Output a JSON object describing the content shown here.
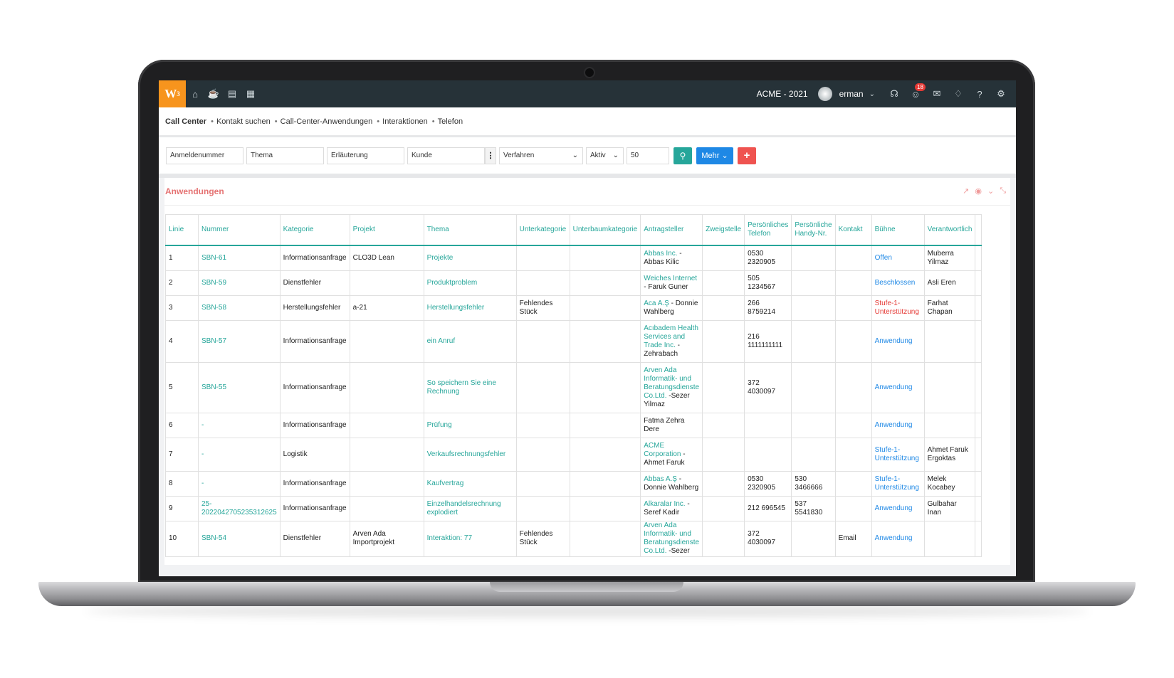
{
  "topbar": {
    "logo": "W",
    "logo_sup": "3",
    "nav_icons": [
      "home-icon",
      "coffee-icon",
      "chart-icon",
      "calendar-icon"
    ],
    "company": "ACME - 2021",
    "username": "erman",
    "notification_count": "18",
    "right_icons": [
      "headset-icon",
      "emoji-icon",
      "chat-icon",
      "bell-icon",
      "help-icon",
      "gear-icon"
    ]
  },
  "breadcrumb": {
    "items": [
      "Call Center",
      "Kontakt suchen",
      "Call-Center-Anwendungen",
      "Interaktionen",
      "Telefon"
    ]
  },
  "filters": {
    "registration_number": "Anmeldenummer",
    "topic": "Thema",
    "explanation": "Erläuterung",
    "customer": "Kunde",
    "procedure": "Verfahren",
    "status": "Aktiv",
    "page_size": "50",
    "more_label": "Mehr",
    "add_label": "+"
  },
  "panel": {
    "title": "Anwendungen"
  },
  "table": {
    "headers": [
      "Linie",
      "Nummer",
      "Kategorie",
      "Projekt",
      "Thema",
      "Unterkategorie",
      "Unterbaumkategorie",
      "Antragsteller",
      "Zweigstelle",
      "Persönliches Telefon",
      "Persönliche Handy-Nr.",
      "Kontakt",
      "Bühne",
      "Verantwortlich",
      ""
    ],
    "rows": [
      {
        "line": "1",
        "number": "SBN-61",
        "category": "Informationsanfrage",
        "project": "CLO3D Lean",
        "topic": "Projekte",
        "subcategory": "",
        "subtree": "",
        "applicant_link": "Abbas Inc.",
        "applicant_rest": " - Abbas Kilic",
        "branch": "",
        "phone": "0530 2320905",
        "mobile": "",
        "contact": "",
        "stage": "Offen",
        "stage_color": "blue",
        "responsible": "Muberra Yilmaz"
      },
      {
        "line": "2",
        "number": "SBN-59",
        "category": "Dienstfehler",
        "project": "",
        "topic": "Produktproblem",
        "subcategory": "",
        "subtree": "",
        "applicant_link": "Weiches Internet",
        "applicant_rest": " - Faruk Guner",
        "branch": "",
        "phone": "505 1234567",
        "mobile": "",
        "contact": "",
        "stage": "Beschlossen",
        "stage_color": "blue",
        "responsible": "Asli Eren"
      },
      {
        "line": "3",
        "number": "SBN-58",
        "category": "Herstellungsfehler",
        "project": "a-21",
        "topic": "Herstellungsfehler",
        "subcategory": "Fehlendes Stück",
        "subtree": "",
        "applicant_link": "Aca A.Ş",
        "applicant_rest": " - Donnie Wahlberg",
        "branch": "",
        "phone": "266 8759214",
        "mobile": "",
        "contact": "",
        "stage": "Stufe-1-Unterstützung",
        "stage_color": "red",
        "responsible": "Farhat Chapan"
      },
      {
        "line": "4",
        "number": "SBN-57",
        "category": "Informationsanfrage",
        "project": "",
        "topic": "ein Anruf",
        "subcategory": "",
        "subtree": "",
        "applicant_link": "Acıbadem Health Services and Trade Inc.",
        "applicant_rest": " - Zehrabach",
        "branch": "",
        "phone": "216 1111111111",
        "mobile": "",
        "contact": "",
        "stage": "Anwendung",
        "stage_color": "blue",
        "responsible": ""
      },
      {
        "line": "5",
        "number": "SBN-55",
        "category": "Informationsanfrage",
        "project": "",
        "topic": "So speichern Sie eine Rechnung",
        "subcategory": "",
        "subtree": "",
        "applicant_link": "Arven Ada Informatik- und Beratungsdienste Co.Ltd.",
        "applicant_rest": " -Sezer Yilmaz",
        "branch": "",
        "phone": "372 4030097",
        "mobile": "",
        "contact": "",
        "stage": "Anwendung",
        "stage_color": "blue",
        "responsible": ""
      },
      {
        "line": "6",
        "number": "-",
        "category": "Informationsanfrage",
        "project": "",
        "topic": "Prüfung",
        "subcategory": "",
        "subtree": "",
        "applicant_link": "",
        "applicant_rest": "Fatma Zehra Dere",
        "branch": "",
        "phone": "",
        "mobile": "",
        "contact": "",
        "stage": "Anwendung",
        "stage_color": "blue",
        "responsible": ""
      },
      {
        "line": "7",
        "number": "-",
        "category": "Logistik",
        "project": "",
        "topic": "Verkaufsrechnungsfehler",
        "subcategory": "",
        "subtree": "",
        "applicant_link": "ACME Corporation",
        "applicant_rest": " - Ahmet Faruk",
        "branch": "",
        "phone": "",
        "mobile": "",
        "contact": "",
        "stage": "Stufe-1-Unterstützung",
        "stage_color": "blue",
        "responsible": "Ahmet Faruk Ergoktas"
      },
      {
        "line": "8",
        "number": "-",
        "category": "Informationsanfrage",
        "project": "",
        "topic": "Kaufvertrag",
        "subcategory": "",
        "subtree": "",
        "applicant_link": "Abbas A.Ş",
        "applicant_rest": " - Donnie Wahlberg",
        "branch": "",
        "phone": "0530 2320905",
        "mobile": "530 3466666",
        "contact": "",
        "stage": "Stufe-1-Unterstützung",
        "stage_color": "blue",
        "responsible": "Melek Kocabey"
      },
      {
        "line": "9",
        "number": "25-2022042705235312625",
        "category": "Informationsanfrage",
        "project": "",
        "topic": "Einzelhandelsrechnung explodiert",
        "subcategory": "",
        "subtree": "",
        "applicant_link": "Alkaralar Inc.",
        "applicant_rest": " - Seref Kadir",
        "branch": "",
        "phone": "212 696545",
        "mobile": "537 5541830",
        "contact": "",
        "stage": "Anwendung",
        "stage_color": "blue",
        "responsible": "Gulbahar Inan"
      },
      {
        "line": "10",
        "number": "SBN-54",
        "category": "Dienstfehler",
        "project": "Arven Ada Importprojekt",
        "topic": "Interaktion: 77",
        "subcategory": "Fehlendes Stück",
        "subtree": "",
        "applicant_link": "Arven Ada Informatik- und Beratungsdienste Co.Ltd.",
        "applicant_rest": " -Sezer",
        "branch": "",
        "phone": "372 4030097",
        "mobile": "",
        "contact": "Email",
        "stage": "Anwendung",
        "stage_color": "blue",
        "responsible": ""
      }
    ]
  },
  "colors": {
    "topbar": "#263238",
    "logo": "#f7941d",
    "accent_teal": "#26a69a",
    "accent_blue": "#1e88e5",
    "accent_red": "#ef5350",
    "panel_title": "#e57373"
  }
}
